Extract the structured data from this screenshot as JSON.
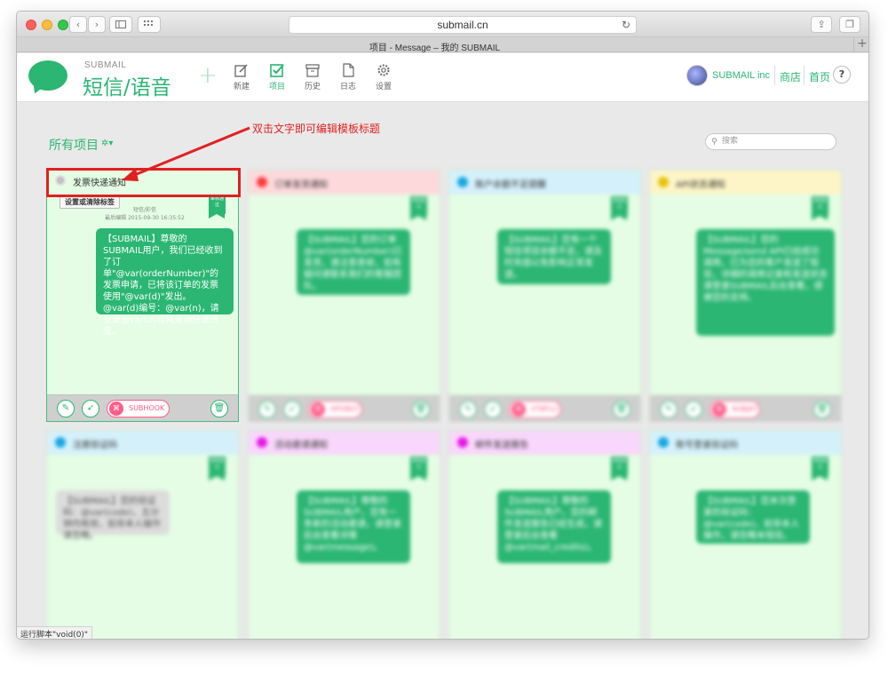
{
  "browser": {
    "url": "submail.cn",
    "tab_title": "项目 - Message – 我的 SUBMAIL"
  },
  "header": {
    "brand_small": "SUBMAIL",
    "brand_big": "短信/语音",
    "nav": [
      {
        "label": "新建",
        "icon": "new-icon"
      },
      {
        "label": "项目",
        "icon": "project-check-icon",
        "active": true
      },
      {
        "label": "历史",
        "icon": "archive-icon"
      },
      {
        "label": "日志",
        "icon": "log-icon"
      },
      {
        "label": "设置",
        "icon": "gear-icon"
      }
    ],
    "account_name": "SUBMAIL inc",
    "links": [
      "商店",
      "首页"
    ],
    "help": "?"
  },
  "main": {
    "section_title": "所有项目",
    "search_placeholder": "搜索",
    "annotation": "双击文字即可编辑模板标题"
  },
  "colors": {
    "brand_green": "#2bb673",
    "annotation_red": "#e02020",
    "tag_pink": "#ff5c8a"
  },
  "cards": [
    {
      "title": "发票快递通知",
      "dot_color": "#bdbdbd",
      "set_tag": "设置或清除标签",
      "flag": "审核通过",
      "meta_type": "短信/彩信",
      "meta_edit": "最后编辑 2015-09-30 16:35:52",
      "message": "【SUBMAIL】尊敬的SUBMAIL用户，我们已经收到了订单\"@var(orderNumber)\"的发票申请，已将该订单的发票使用\"@var(d)\"发出。@var(d)编号：@var(n)，请登录@var(d)官网查询快递进度。",
      "tag": "SUBHOOK"
    },
    {
      "title": "订单发货通知",
      "dot_color": "#ff3b3b",
      "head_bg": "#fdd9dc",
      "flag": "审核通过",
      "message": "【SUBMAIL】您的订单@var(orderNumber)已发货，请注意查收，如有疑问请联系我们的客服团队。",
      "tag": "HPVBGT"
    },
    {
      "title": "账户余额不足提醒",
      "dot_color": "#17a8e0",
      "head_bg": "#d4f1fb",
      "flag": "审核通过",
      "message": "【SUBMAIL】您有一个短信项目余额不足，请及时充值以免影响正常发送。",
      "tag": "VTBFLU"
    },
    {
      "title": "API状态通知",
      "dot_color": "#e6c30a",
      "head_bg": "#fdf5c7",
      "flag": "审核通过",
      "message": "【SUBMAIL】您的Message/send API已经成功调用，已为您的客户发送了短信，详细的调用记录和发送状态请登录SUBMAIL后台查看，感谢您的支持。",
      "tag": "9OBJKT"
    },
    {
      "title": "注册验证码",
      "dot_color": "#17a8e0",
      "head_bg": "#d4f1fb",
      "flag": "审核通过",
      "message": "【SUBMAIL】您的验证码：@var(code)，五分钟内有效，如非本人操作请忽略。",
      "tag": ""
    },
    {
      "title": "活动邀请通知",
      "dot_color": "#e619e6",
      "head_bg": "#f9d6fb",
      "flag": "审核通过",
      "message": "【SUBMAIL】尊敬的SUBMAIL用户，您有一条新的活动邀请，请登录后台查看详情@var(message)。",
      "tag": ""
    },
    {
      "title": "邮件发送报告",
      "dot_color": "#e619e6",
      "head_bg": "#f9d6fb",
      "flag": "审核通过",
      "message": "【SUBMAIL】尊敬的SUBMAIL用户，您的邮件发送报告已经生成，请登录后台查看@var(mail_credits)。",
      "tag": ""
    },
    {
      "title": "账号登录验证码",
      "dot_color": "#17a8e0",
      "head_bg": "#d4f1fb",
      "flag": "审核通过",
      "message": "【SUBMAIL】您本次登录的验证码：@var(code)，如非本人操作，请忽略本短信。",
      "tag": ""
    }
  ],
  "status_bar": "运行脚本\"void(0)\""
}
